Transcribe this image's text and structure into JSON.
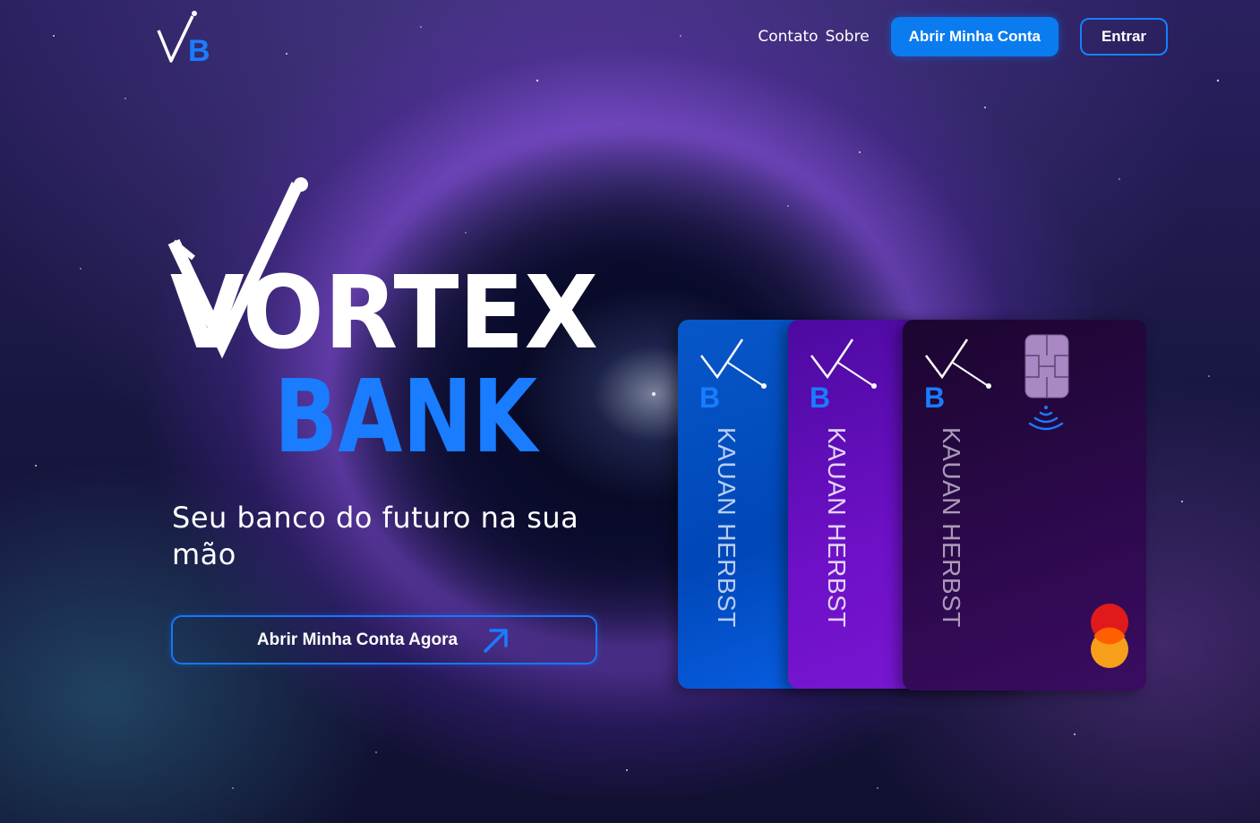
{
  "header": {
    "logo_text": "VB",
    "nav": {
      "contact": "Contato",
      "about": "Sobre"
    },
    "open_account": "Abrir Minha Conta",
    "login": "Entrar"
  },
  "hero": {
    "brand_line1": "VORTEX",
    "brand_line2": "BANK",
    "tagline": "Seu banco do futuro na sua mão",
    "cta_label": "Abrir Minha Conta Agora"
  },
  "cards": [
    {
      "holder": "KAUAN HERBST",
      "logo_text": "VB",
      "color": "#0757c8"
    },
    {
      "holder": "KAUAN HERBST",
      "logo_text": "VB",
      "color": "#6d10c6"
    },
    {
      "holder": "KAUAN HERBST",
      "logo_text": "VB",
      "color": "#2a0848"
    }
  ],
  "colors": {
    "accent": "#0a7cf0",
    "brand_blue": "#1a7cff",
    "white": "#ffffff"
  },
  "icons": [
    "vb-logo-icon",
    "arrow-up-right-icon",
    "chip-icon",
    "contactless-icon",
    "mastercard-icon"
  ]
}
